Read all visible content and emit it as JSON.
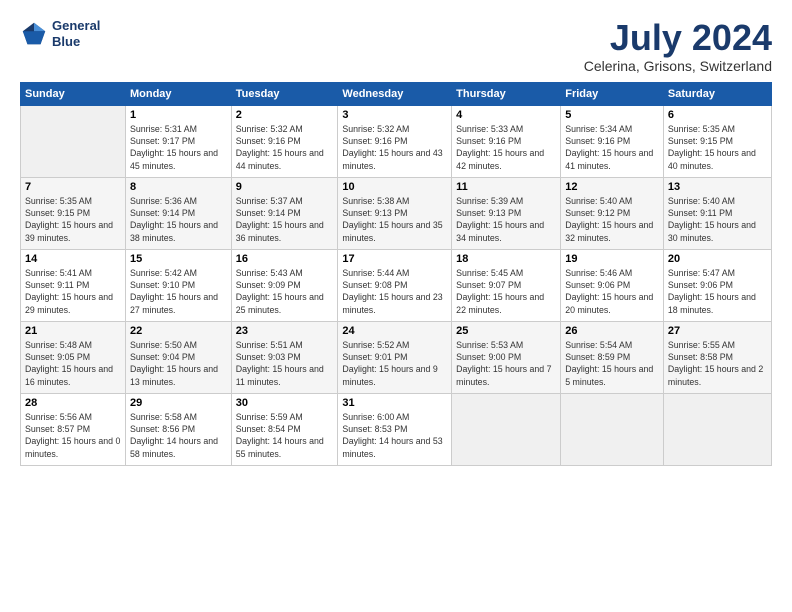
{
  "header": {
    "logo_line1": "General",
    "logo_line2": "Blue",
    "title": "July 2024",
    "subtitle": "Celerina, Grisons, Switzerland"
  },
  "columns": [
    "Sunday",
    "Monday",
    "Tuesday",
    "Wednesday",
    "Thursday",
    "Friday",
    "Saturday"
  ],
  "weeks": [
    [
      {
        "day": "",
        "sunrise": "",
        "sunset": "",
        "daylight": ""
      },
      {
        "day": "1",
        "sunrise": "Sunrise: 5:31 AM",
        "sunset": "Sunset: 9:17 PM",
        "daylight": "Daylight: 15 hours and 45 minutes."
      },
      {
        "day": "2",
        "sunrise": "Sunrise: 5:32 AM",
        "sunset": "Sunset: 9:16 PM",
        "daylight": "Daylight: 15 hours and 44 minutes."
      },
      {
        "day": "3",
        "sunrise": "Sunrise: 5:32 AM",
        "sunset": "Sunset: 9:16 PM",
        "daylight": "Daylight: 15 hours and 43 minutes."
      },
      {
        "day": "4",
        "sunrise": "Sunrise: 5:33 AM",
        "sunset": "Sunset: 9:16 PM",
        "daylight": "Daylight: 15 hours and 42 minutes."
      },
      {
        "day": "5",
        "sunrise": "Sunrise: 5:34 AM",
        "sunset": "Sunset: 9:16 PM",
        "daylight": "Daylight: 15 hours and 41 minutes."
      },
      {
        "day": "6",
        "sunrise": "Sunrise: 5:35 AM",
        "sunset": "Sunset: 9:15 PM",
        "daylight": "Daylight: 15 hours and 40 minutes."
      }
    ],
    [
      {
        "day": "7",
        "sunrise": "Sunrise: 5:35 AM",
        "sunset": "Sunset: 9:15 PM",
        "daylight": "Daylight: 15 hours and 39 minutes."
      },
      {
        "day": "8",
        "sunrise": "Sunrise: 5:36 AM",
        "sunset": "Sunset: 9:14 PM",
        "daylight": "Daylight: 15 hours and 38 minutes."
      },
      {
        "day": "9",
        "sunrise": "Sunrise: 5:37 AM",
        "sunset": "Sunset: 9:14 PM",
        "daylight": "Daylight: 15 hours and 36 minutes."
      },
      {
        "day": "10",
        "sunrise": "Sunrise: 5:38 AM",
        "sunset": "Sunset: 9:13 PM",
        "daylight": "Daylight: 15 hours and 35 minutes."
      },
      {
        "day": "11",
        "sunrise": "Sunrise: 5:39 AM",
        "sunset": "Sunset: 9:13 PM",
        "daylight": "Daylight: 15 hours and 34 minutes."
      },
      {
        "day": "12",
        "sunrise": "Sunrise: 5:40 AM",
        "sunset": "Sunset: 9:12 PM",
        "daylight": "Daylight: 15 hours and 32 minutes."
      },
      {
        "day": "13",
        "sunrise": "Sunrise: 5:40 AM",
        "sunset": "Sunset: 9:11 PM",
        "daylight": "Daylight: 15 hours and 30 minutes."
      }
    ],
    [
      {
        "day": "14",
        "sunrise": "Sunrise: 5:41 AM",
        "sunset": "Sunset: 9:11 PM",
        "daylight": "Daylight: 15 hours and 29 minutes."
      },
      {
        "day": "15",
        "sunrise": "Sunrise: 5:42 AM",
        "sunset": "Sunset: 9:10 PM",
        "daylight": "Daylight: 15 hours and 27 minutes."
      },
      {
        "day": "16",
        "sunrise": "Sunrise: 5:43 AM",
        "sunset": "Sunset: 9:09 PM",
        "daylight": "Daylight: 15 hours and 25 minutes."
      },
      {
        "day": "17",
        "sunrise": "Sunrise: 5:44 AM",
        "sunset": "Sunset: 9:08 PM",
        "daylight": "Daylight: 15 hours and 23 minutes."
      },
      {
        "day": "18",
        "sunrise": "Sunrise: 5:45 AM",
        "sunset": "Sunset: 9:07 PM",
        "daylight": "Daylight: 15 hours and 22 minutes."
      },
      {
        "day": "19",
        "sunrise": "Sunrise: 5:46 AM",
        "sunset": "Sunset: 9:06 PM",
        "daylight": "Daylight: 15 hours and 20 minutes."
      },
      {
        "day": "20",
        "sunrise": "Sunrise: 5:47 AM",
        "sunset": "Sunset: 9:06 PM",
        "daylight": "Daylight: 15 hours and 18 minutes."
      }
    ],
    [
      {
        "day": "21",
        "sunrise": "Sunrise: 5:48 AM",
        "sunset": "Sunset: 9:05 PM",
        "daylight": "Daylight: 15 hours and 16 minutes."
      },
      {
        "day": "22",
        "sunrise": "Sunrise: 5:50 AM",
        "sunset": "Sunset: 9:04 PM",
        "daylight": "Daylight: 15 hours and 13 minutes."
      },
      {
        "day": "23",
        "sunrise": "Sunrise: 5:51 AM",
        "sunset": "Sunset: 9:03 PM",
        "daylight": "Daylight: 15 hours and 11 minutes."
      },
      {
        "day": "24",
        "sunrise": "Sunrise: 5:52 AM",
        "sunset": "Sunset: 9:01 PM",
        "daylight": "Daylight: 15 hours and 9 minutes."
      },
      {
        "day": "25",
        "sunrise": "Sunrise: 5:53 AM",
        "sunset": "Sunset: 9:00 PM",
        "daylight": "Daylight: 15 hours and 7 minutes."
      },
      {
        "day": "26",
        "sunrise": "Sunrise: 5:54 AM",
        "sunset": "Sunset: 8:59 PM",
        "daylight": "Daylight: 15 hours and 5 minutes."
      },
      {
        "day": "27",
        "sunrise": "Sunrise: 5:55 AM",
        "sunset": "Sunset: 8:58 PM",
        "daylight": "Daylight: 15 hours and 2 minutes."
      }
    ],
    [
      {
        "day": "28",
        "sunrise": "Sunrise: 5:56 AM",
        "sunset": "Sunset: 8:57 PM",
        "daylight": "Daylight: 15 hours and 0 minutes."
      },
      {
        "day": "29",
        "sunrise": "Sunrise: 5:58 AM",
        "sunset": "Sunset: 8:56 PM",
        "daylight": "Daylight: 14 hours and 58 minutes."
      },
      {
        "day": "30",
        "sunrise": "Sunrise: 5:59 AM",
        "sunset": "Sunset: 8:54 PM",
        "daylight": "Daylight: 14 hours and 55 minutes."
      },
      {
        "day": "31",
        "sunrise": "Sunrise: 6:00 AM",
        "sunset": "Sunset: 8:53 PM",
        "daylight": "Daylight: 14 hours and 53 minutes."
      },
      {
        "day": "",
        "sunrise": "",
        "sunset": "",
        "daylight": ""
      },
      {
        "day": "",
        "sunrise": "",
        "sunset": "",
        "daylight": ""
      },
      {
        "day": "",
        "sunrise": "",
        "sunset": "",
        "daylight": ""
      }
    ]
  ]
}
